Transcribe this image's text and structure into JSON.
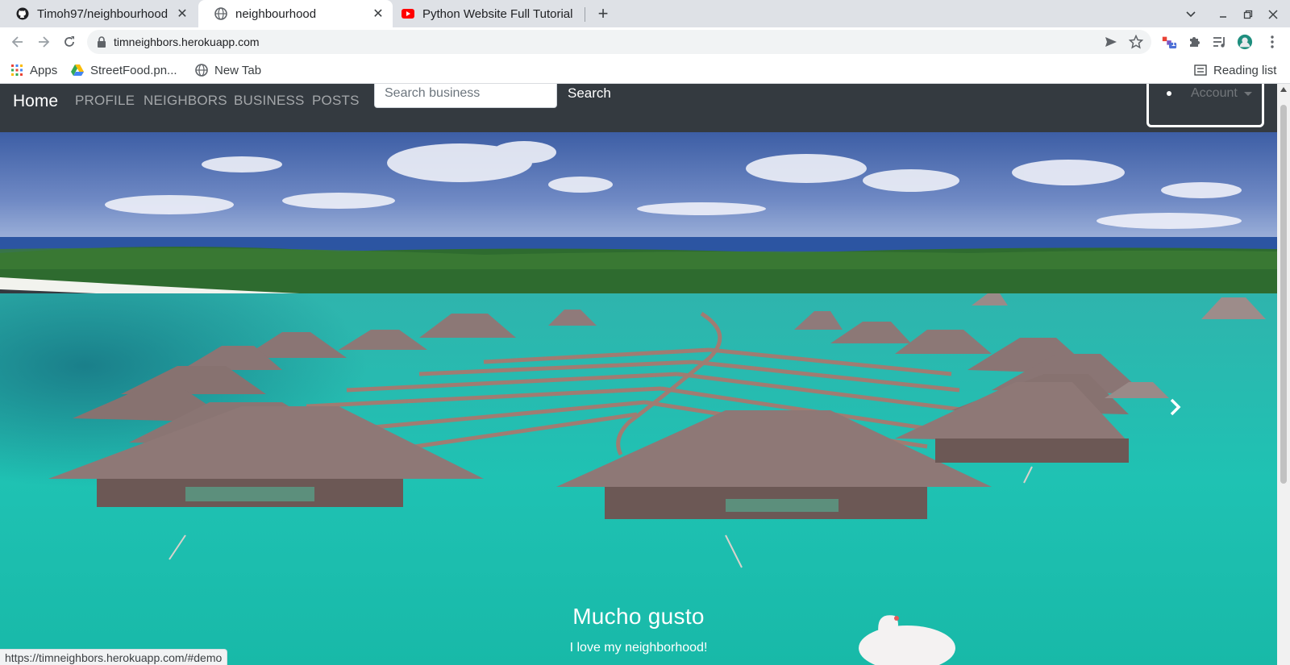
{
  "browser": {
    "tabs": [
      {
        "title": "Timoh97/neighbourhood",
        "icon": "github-icon",
        "active": false
      },
      {
        "title": "neighbourhood",
        "icon": "globe-icon",
        "active": true
      },
      {
        "title": "Python Website Full Tutorial",
        "icon": "youtube-icon",
        "active": false
      }
    ],
    "url": "timneighbors.herokuapp.com",
    "bookmarks": [
      {
        "label": "Apps",
        "icon": "apps-grid-icon"
      },
      {
        "label": "StreetFood.pn...",
        "icon": "google-drive-icon"
      },
      {
        "label": "New Tab",
        "icon": "globe-icon"
      }
    ],
    "reading_list": "Reading list",
    "extension_badge": "1",
    "status_url": "https://timneighbors.herokuapp.com/#demo"
  },
  "navbar": {
    "brand": "Home",
    "links": [
      "PROFILE",
      "NEIGHBORS",
      "BUSINESS",
      "POSTS"
    ],
    "search_placeholder": "Search business",
    "search_button": "Search",
    "account": "Account"
  },
  "carousel": {
    "caption_title": "Mucho gusto",
    "caption_text": "I love my neighborhood!",
    "next_icon": "chevron-right-icon"
  },
  "colors": {
    "navbar_bg": "#343a40",
    "tabstrip_bg": "#dee1e6",
    "lagoon": "#22c1b6",
    "sky": "#4f6fb0"
  }
}
